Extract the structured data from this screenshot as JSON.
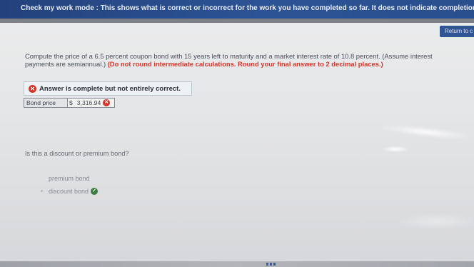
{
  "banner": {
    "text": "Check my work mode : This shows what is correct or incorrect for the work you have completed so far. It does not indicate completion."
  },
  "return_button": {
    "label": "Return to c"
  },
  "question": {
    "text": "Compute the price of a 6.5 percent coupon bond with 15 years left to maturity and a market interest rate of 10.8 percent. (Assume interest payments are semiannual.)",
    "instruction": "(Do not round intermediate calculations. Round your final answer to 2 decimal places.)"
  },
  "feedback": {
    "icon": "x-circle-icon",
    "text": "Answer is complete but not entirely correct."
  },
  "answer": {
    "label": "Bond price",
    "currency": "$",
    "value": "3,316.94",
    "status": "incorrect"
  },
  "question2": {
    "text": "Is this a discount or premium bond?",
    "options": [
      {
        "label": "premium bond",
        "selected": false
      },
      {
        "label": "discount bond",
        "selected": true,
        "status": "correct"
      }
    ]
  },
  "colors": {
    "banner": "#2c5395",
    "warning_text": "#d8352b",
    "incorrect": "#d3342a",
    "correct": "#3b7d3f"
  }
}
